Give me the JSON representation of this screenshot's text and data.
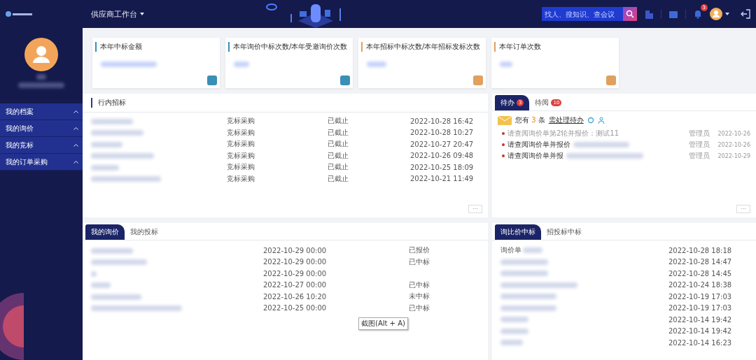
{
  "header": {
    "title": "供应商工作台",
    "search": {
      "placeholder": "找人、搜知识、查会议"
    },
    "notification_count": "3"
  },
  "sidebar": {
    "menu": [
      {
        "label": "我的档案",
        "expanded": false
      },
      {
        "label": "我的询价",
        "expanded": false
      },
      {
        "label": "我的竞标",
        "expanded": false
      },
      {
        "label": "我的订单采购",
        "expanded": false
      }
    ]
  },
  "stat_cards": [
    {
      "title": "本年中标金额",
      "color": "#3a8fb7"
    },
    {
      "title": "本年询价中标次数/本年受邀询价次数",
      "color": "#3a8fb7"
    },
    {
      "title": "本年招标中标次数/本年招标发标次数",
      "color": "#e0a060"
    },
    {
      "title": "本年订单次数",
      "color": "#e0a060"
    }
  ],
  "bidding": {
    "title": "行内招标",
    "rows": [
      {
        "type": "竞标采购",
        "status": "已截止",
        "time": "2022-10-28 16:42"
      },
      {
        "type": "竞标采购",
        "status": "已截止",
        "time": "2022-10-28 10:27"
      },
      {
        "type": "竞标采购",
        "status": "已截止",
        "time": "2022-10-27 20:47"
      },
      {
        "type": "竞标采购",
        "status": "已截止",
        "time": "2022-10-26 09:48"
      },
      {
        "type": "竞标采购",
        "status": "已截止",
        "time": "2022-10-25 18:09"
      },
      {
        "type": "竞标采购",
        "status": "已截止",
        "time": "2022-10-21 11:49"
      }
    ],
    "more": "···"
  },
  "todo": {
    "tabs": [
      {
        "label": "待办",
        "count": "3",
        "selected": true
      },
      {
        "label": "待阅",
        "count": "10",
        "selected": false
      }
    ],
    "summary": {
      "prefix": "您有",
      "count": "3",
      "unit": "条",
      "link": "需处理待办"
    },
    "items": [
      {
        "text": "请查阅询价单第2轮并报价：测试11",
        "author": "管理员",
        "date": "2022-10-26",
        "read": true
      },
      {
        "text": "请查阅询价单并报价",
        "author": "管理员",
        "date": "2022-10-26",
        "read": false
      },
      {
        "text": "请查阅询价单并报",
        "author": "管理员",
        "date": "2022-10-29",
        "read": false
      }
    ],
    "more": "···"
  },
  "my_inquiries": {
    "tabs": [
      {
        "label": "我的询价",
        "selected": true
      },
      {
        "label": "我的投标",
        "selected": false
      }
    ],
    "rows": [
      {
        "time": "2022-10-29 00:00",
        "status": "已报价"
      },
      {
        "time": "2022-10-29 00:00",
        "status": "已中标"
      },
      {
        "time": "2022-10-29 00:00"
      },
      {
        "time": "2022-10-27 00:00",
        "status": "已中标"
      },
      {
        "time": "2022-10-26 10:20",
        "status": "未中标"
      },
      {
        "time": "2022-10-25 00:00",
        "status": "已中标"
      }
    ]
  },
  "awards": {
    "tabs": [
      {
        "label": "询比价中标",
        "selected": true
      },
      {
        "label": "招投标中标",
        "selected": false
      }
    ],
    "rows": [
      {
        "name": "询价单",
        "time": "2022-10-28 18:18"
      },
      {
        "time": "2022-10-28 14:47"
      },
      {
        "time": "2022-10-28 14:45"
      },
      {
        "time": "2022-10-24 18:38"
      },
      {
        "time": "2022-10-19 17:03"
      },
      {
        "time": "2022-10-19 17:03"
      },
      {
        "time": "2022-10-14 19:42"
      },
      {
        "time": "2022-10-14 19:42"
      },
      {
        "time": "2022-10-14 16:23"
      }
    ]
  },
  "tooltip": "截图(Alt + A)"
}
